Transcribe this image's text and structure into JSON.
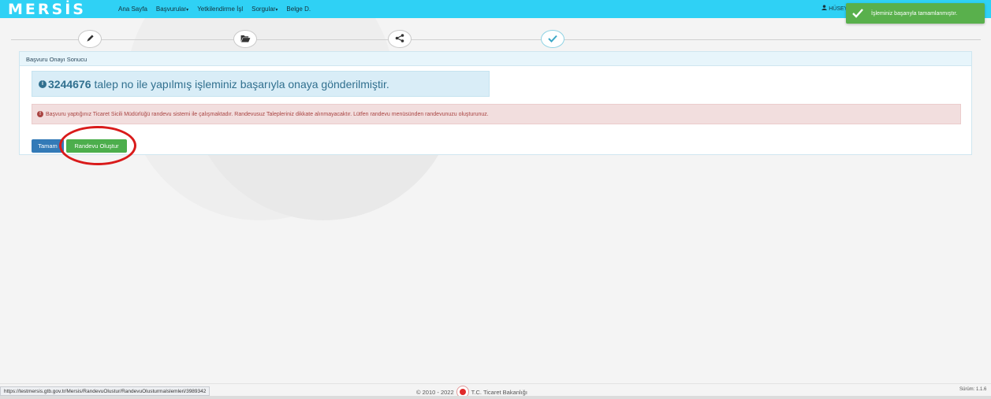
{
  "navbar": {
    "logo": "MERSİS",
    "links": [
      {
        "label": "Ana Sayfa",
        "caret": ""
      },
      {
        "label": "Başvurular",
        "caret": "▾"
      },
      {
        "label": "Yetkilendirme İşl",
        "caret": ""
      },
      {
        "label": "Sorgular",
        "caret": "▾"
      },
      {
        "label": "Belge D.",
        "caret": ""
      }
    ],
    "user": "HÜSEY"
  },
  "toast": {
    "text": "İşleminiz başarıyla tamamlanmıştır."
  },
  "wizard": {
    "steps": [
      {
        "icon": "pencil-icon"
      },
      {
        "icon": "folder-open-icon"
      },
      {
        "icon": "share-icon"
      },
      {
        "icon": "check-icon"
      }
    ]
  },
  "panel": {
    "title": "Başvuru Onayı Sonucu",
    "info": {
      "icon": "i",
      "talep_no": "3244676",
      "message": "talep no ile yapılmış işleminiz başarıyla onaya gönderilmiştir."
    },
    "warning": {
      "icon": "!",
      "message": "Başvuru yaptığınız Ticaret Sicili Müdürlüğü randevu sistemi ile çalışmaktadır. Randevusuz Talepleriniz dikkate alınmayacaktır. Lütfen randevu menüsünden randevunuzu oluşturunuz."
    },
    "buttons": {
      "tamam": "Tamam",
      "randevu": "Randevu Oluştur"
    }
  },
  "footer": {
    "status_url": "https://testmersis.gtb.gov.tr/Mersis/RandevuOlustur/RandevuOlusturmaIslemleri/3989342",
    "copyright": "© 2010 - 2022",
    "ministry": "T.C. Ticaret Bakanlığı",
    "version": "Sürüm: 1.1.6"
  },
  "colors": {
    "navbar": "#2fd1f5",
    "toast": "#59b04c",
    "primary": "#337ab7",
    "success": "#4cae4c",
    "highlight": "#d91b1b"
  }
}
